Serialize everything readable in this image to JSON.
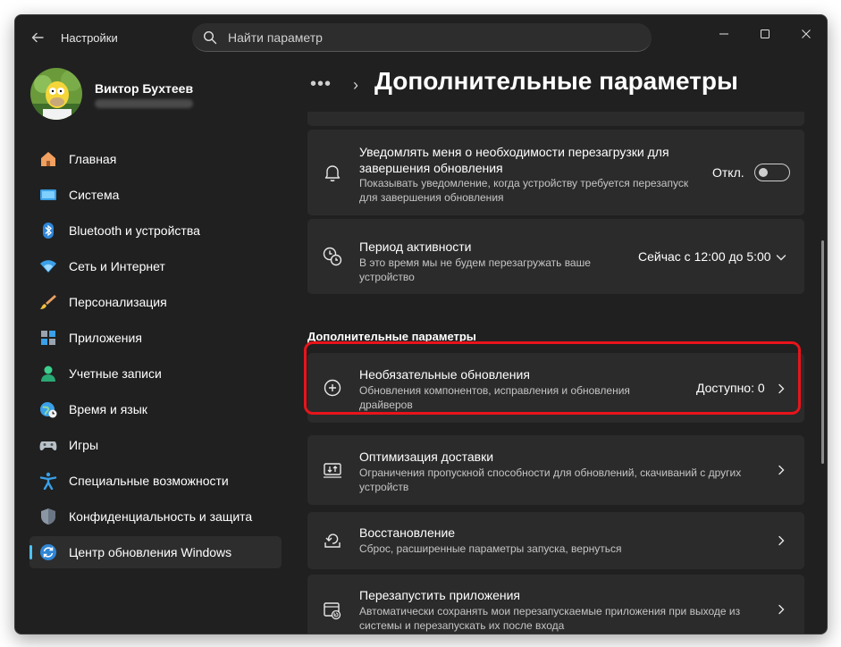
{
  "titlebar": {
    "app_title": "Настройки",
    "search_placeholder": "Найти параметр",
    "controls": [
      "minimize-icon",
      "maximize-icon",
      "close-icon"
    ]
  },
  "profile": {
    "name": "Виктор Бухтеев"
  },
  "nav": {
    "items": [
      {
        "label": "Главная",
        "icon": "home-icon"
      },
      {
        "label": "Система",
        "icon": "system-icon"
      },
      {
        "label": "Bluetooth и устройства",
        "icon": "bluetooth-icon"
      },
      {
        "label": "Сеть и Интернет",
        "icon": "wifi-icon"
      },
      {
        "label": "Персонализация",
        "icon": "brush-icon"
      },
      {
        "label": "Приложения",
        "icon": "apps-icon"
      },
      {
        "label": "Учетные записи",
        "icon": "account-icon"
      },
      {
        "label": "Время и язык",
        "icon": "globe-clock-icon"
      },
      {
        "label": "Игры",
        "icon": "gamepad-icon"
      },
      {
        "label": "Специальные возможности",
        "icon": "accessibility-icon"
      },
      {
        "label": "Конфиденциальность и защита",
        "icon": "shield-icon"
      },
      {
        "label": "Центр обновления Windows",
        "icon": "update-icon",
        "active": true
      }
    ]
  },
  "breadcrumb": {
    "dots": "•••",
    "separator": "›",
    "title": "Дополнительные параметры"
  },
  "cards": {
    "notify": {
      "title": "Уведомлять меня о необходимости перезагрузки для завершения обновления",
      "subtitle": "Показывать уведомление, когда устройству требуется перезапуск для завершения обновления",
      "toggle_label": "Откл.",
      "toggle_on": false,
      "icon": "bell-icon"
    },
    "active_hours": {
      "title": "Период активности",
      "subtitle": "В это время мы не будем перезагружать ваше устройство",
      "value": "Сейчас с 12:00 до 5:00",
      "icon": "active-hours-icon"
    },
    "section_heading": "Дополнительные параметры",
    "optional_updates": {
      "title": "Необязательные обновления",
      "subtitle": "Обновления компонентов, исправления и обновления драйверов",
      "value": "Доступно: 0",
      "icon": "plus-circle-icon"
    },
    "delivery": {
      "title": "Оптимизация доставки",
      "subtitle": "Ограничения пропускной способности для обновлений, скачиваний с других устройств",
      "icon": "delivery-icon"
    },
    "recovery": {
      "title": "Восстановление",
      "subtitle": "Сброс, расширенные параметры запуска, вернуться",
      "icon": "recovery-icon"
    },
    "restart_apps": {
      "title": "Перезапустить приложения",
      "subtitle": "Автоматически сохранять мои перезапускаемые приложения при выходе из системы и перезапускать их после входа",
      "icon": "restart-apps-icon"
    }
  },
  "colors": {
    "window_bg": "#202020",
    "card_bg": "#2b2b2b",
    "accent": "#4cc2ff",
    "highlight": "#e8141b"
  }
}
